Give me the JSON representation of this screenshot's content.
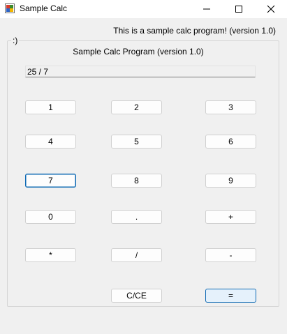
{
  "window": {
    "title": "Sample Calc",
    "icon": "app-icon",
    "controls": [
      "minimize-icon",
      "maximize-icon",
      "close-icon"
    ]
  },
  "status_text": "This is a sample calc program! (version 1.0)",
  "group_caption": ":)",
  "heading": "Sample Calc Program (version 1.0)",
  "display_value": "25 / 7",
  "buttons": {
    "one": "1",
    "two": "2",
    "three": "3",
    "four": "4",
    "five": "5",
    "six": "6",
    "seven": "7",
    "eight": "8",
    "nine": "9",
    "zero": "0",
    "dot": ".",
    "plus": "+",
    "multiply": "*",
    "divide": "/",
    "minus": "-",
    "clear": "C/CE",
    "equals": "="
  },
  "colors": {
    "focus_border": "#0f6ab4",
    "default_button_fill": "#e5f1fb",
    "window_background": "#f0f0f0"
  }
}
